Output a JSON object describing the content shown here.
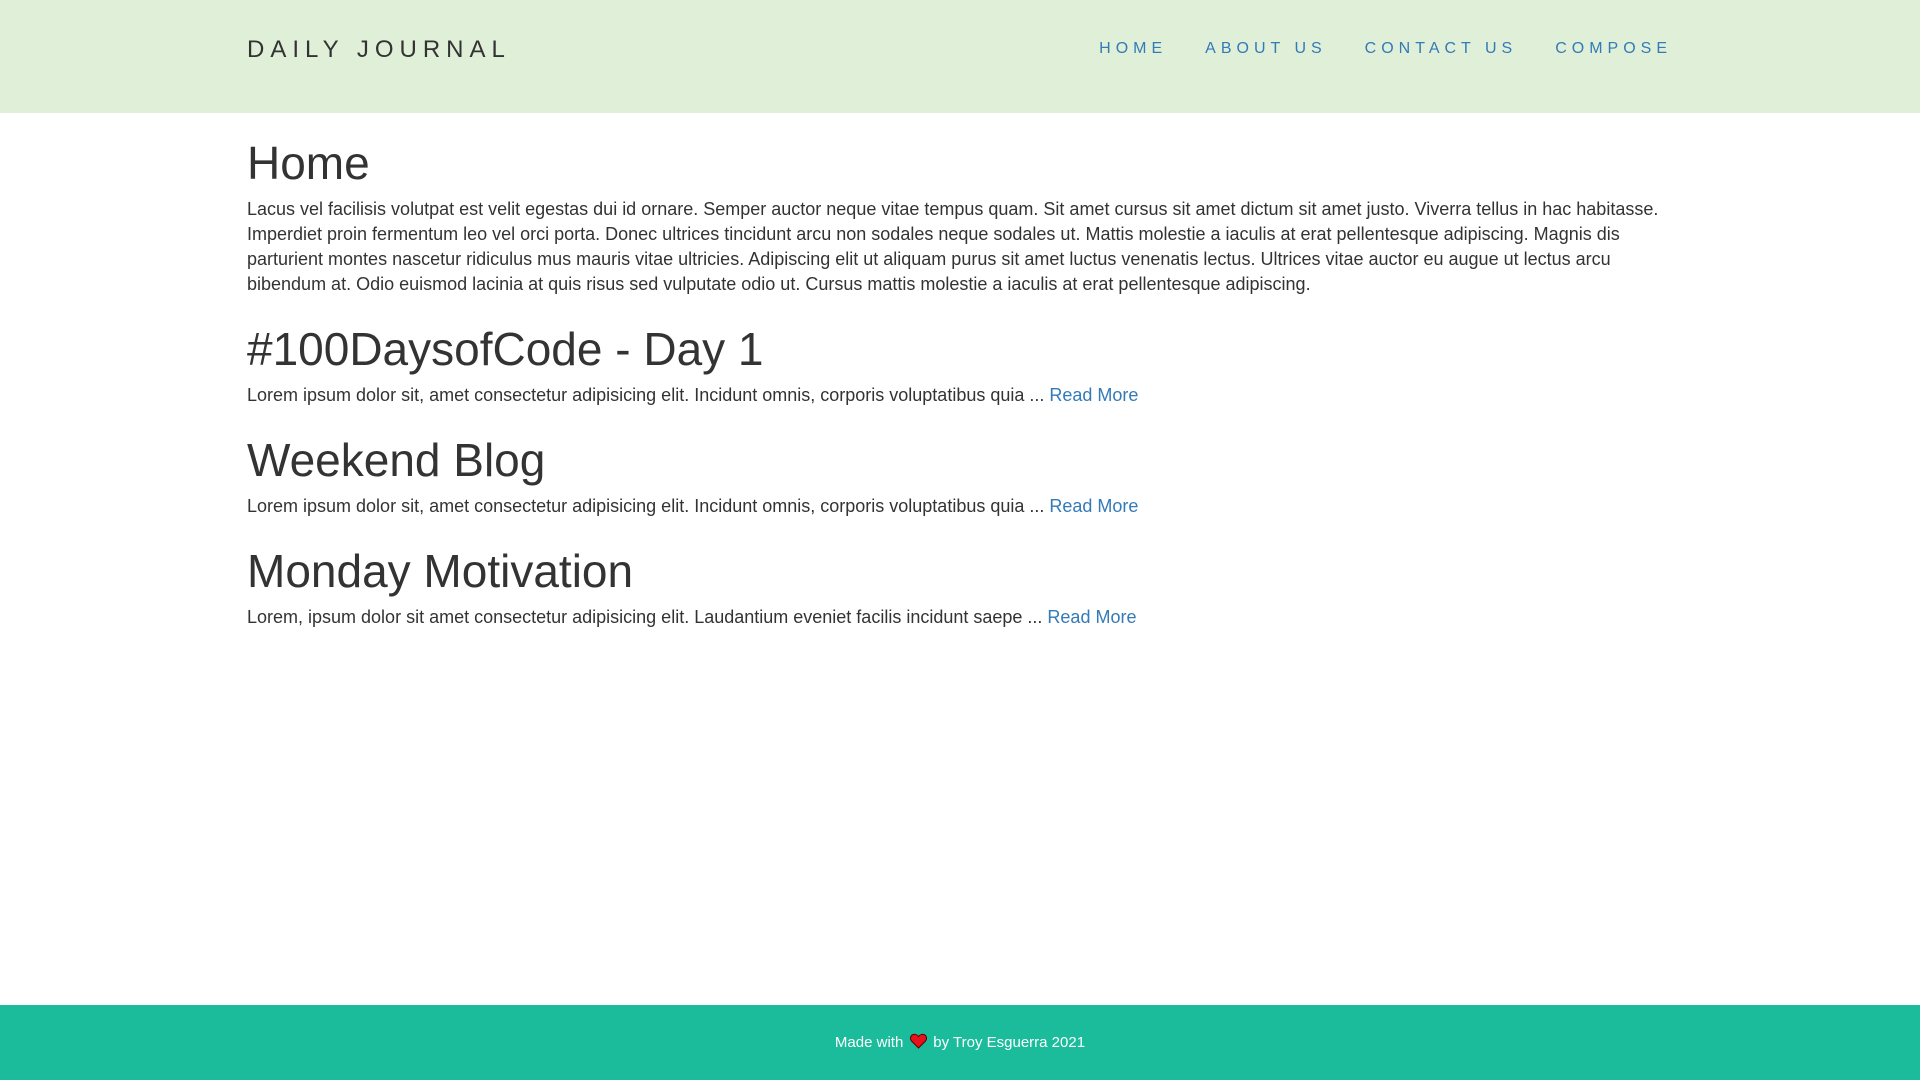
{
  "navbar": {
    "brand": "DAILY JOURNAL",
    "links": [
      "HOME",
      "ABOUT US",
      "CONTACT US",
      "COMPOSE"
    ]
  },
  "main": {
    "title": "Home",
    "intro": "Lacus vel facilisis volutpat est velit egestas dui id ornare. Semper auctor neque vitae tempus quam. Sit amet cursus sit amet dictum sit amet justo. Viverra tellus in hac habitasse. Imperdiet proin fermentum leo vel orci porta. Donec ultrices tincidunt arcu non sodales neque sodales ut. Mattis molestie a iaculis at erat pellentesque adipiscing. Magnis dis parturient montes nascetur ridiculus mus mauris vitae ultricies. Adipiscing elit ut aliquam purus sit amet luctus venenatis lectus. Ultrices vitae auctor eu augue ut lectus arcu bibendum at. Odio euismod lacinia at quis risus sed vulputate odio ut. Cursus mattis molestie a iaculis at erat pellentesque adipiscing.",
    "posts": [
      {
        "title": "#100DaysofCode - Day 1",
        "excerpt": "Lorem ipsum dolor sit, amet consectetur adipisicing elit. Incidunt omnis, corporis voluptatibus quia ... ",
        "read_more": "Read More"
      },
      {
        "title": "Weekend Blog",
        "excerpt": "Lorem ipsum dolor sit, amet consectetur adipisicing elit. Incidunt omnis, corporis voluptatibus quia ... ",
        "read_more": "Read More"
      },
      {
        "title": "Monday Motivation",
        "excerpt": "Lorem, ipsum dolor sit amet consectetur adipisicing elit. Laudantium eveniet facilis incidunt saepe ... ",
        "read_more": "Read More"
      }
    ]
  },
  "footer": {
    "prefix": "Made with",
    "icon": "heart-icon",
    "suffix": "by Troy Esguerra 2021"
  },
  "colors": {
    "navbar_bg": "#e0f0d8",
    "link": "#337ab7",
    "footer_bg": "#1abc9c",
    "heart": "#e8111b"
  }
}
